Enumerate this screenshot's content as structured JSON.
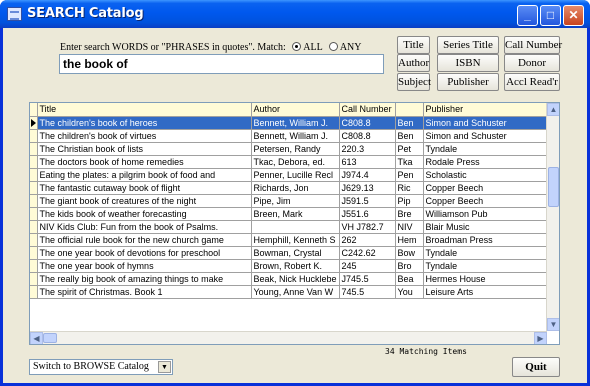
{
  "window": {
    "title": "SEARCH Catalog",
    "controls": [
      "_",
      "□",
      "✕"
    ]
  },
  "search": {
    "instructions": "Enter search WORDS or \"PHRASES in quotes\".",
    "match_label": "Match:",
    "options": [
      "ALL",
      "ANY"
    ],
    "selected_option": "ALL",
    "query": "the book of"
  },
  "buttons": {
    "title": "Title",
    "series_title": "Series Title",
    "call_number": "Call Number",
    "author": "Author",
    "isbn": "ISBN",
    "donor": "Donor",
    "subject": "Subject",
    "publisher": "Publisher",
    "accl_readr": "Accl Read'r",
    "quit": "Quit"
  },
  "table": {
    "columns": [
      "Title",
      "Author",
      "Call Number",
      "",
      "Publisher"
    ],
    "rows": [
      [
        "The children's book of heroes",
        "Bennett, William J.",
        "C808.8",
        "Ben",
        "Simon and Schuster"
      ],
      [
        "The children's book of virtues",
        "Bennett, William J.",
        "C808.8",
        "Ben",
        "Simon and Schuster"
      ],
      [
        "The Christian book of lists",
        "Petersen, Randy",
        "220.3",
        "Pet",
        "Tyndale"
      ],
      [
        "The doctors book of home remedies",
        "Tkac, Debora, ed.",
        "613",
        "Tka",
        "Rodale Press"
      ],
      [
        "Eating the plates:  a pilgrim book of food and",
        "Penner, Lucille Recl",
        "J974.4",
        "Pen",
        "Scholastic"
      ],
      [
        "The fantastic cutaway book of flight",
        "Richards, Jon",
        "J629.13",
        "Ric",
        "Copper Beech"
      ],
      [
        "The giant book of creatures of the night",
        "Pipe, Jim",
        "J591.5",
        "Pip",
        "Copper Beech"
      ],
      [
        "The kids book of weather forecasting",
        "Breen, Mark",
        "J551.6",
        "Bre",
        "Williamson Pub"
      ],
      [
        "NIV Kids Club:  Fun from the book of Psalms.",
        "",
        "VH J782.7",
        "NIV",
        "Blair Music"
      ],
      [
        "The official rule book for the new church game",
        "Hemphill, Kenneth S",
        "262",
        "Hem",
        "Broadman Press"
      ],
      [
        "The one year book of devotions for preschool",
        "Bowman, Crystal",
        "C242.62",
        "Bow",
        "Tyndale"
      ],
      [
        "The one year book of hymns",
        "Brown, Robert K.",
        "245",
        "Bro",
        "Tyndale"
      ],
      [
        "The really big book of amazing things to make",
        "Beak, Nick Hucklebe",
        "J745.5",
        "Bea",
        "Hermes House"
      ],
      [
        "The spirit of Christmas.  Book 1",
        "Young, Anne Van W",
        "745.5",
        "You",
        "Leisure Arts"
      ]
    ],
    "selected_row": 0,
    "match_count": "34 Matching Items"
  },
  "catalog_switch": {
    "selected": "Switch to BROWSE Catalog"
  }
}
